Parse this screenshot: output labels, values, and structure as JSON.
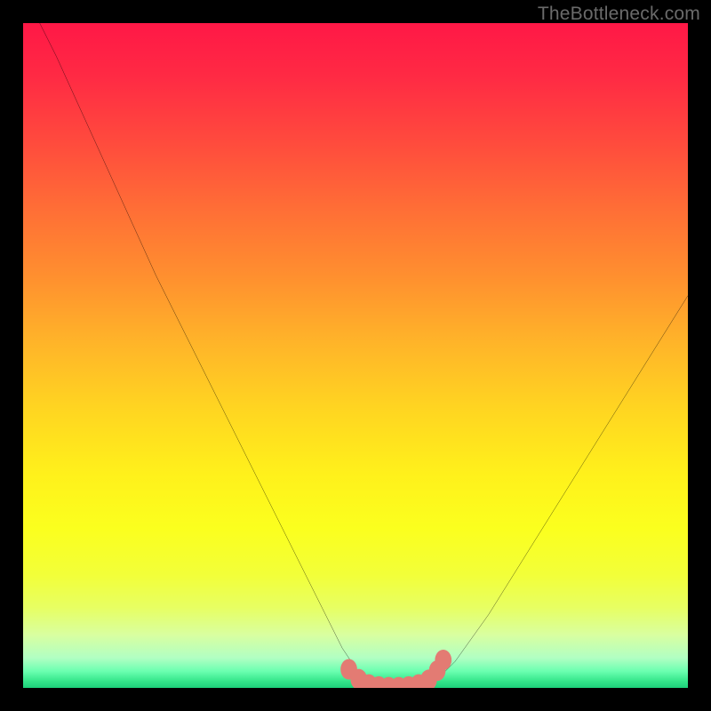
{
  "watermark": {
    "text": "TheBottleneck.com"
  },
  "chart_data": {
    "type": "line",
    "title": "",
    "xlabel": "",
    "ylabel": "",
    "xlim": [
      0,
      100
    ],
    "ylim": [
      0,
      100
    ],
    "grid": false,
    "series": [
      {
        "name": "bottleneck-curve",
        "x": [
          0,
          5,
          10,
          15,
          20,
          25,
          30,
          35,
          40,
          45,
          48,
          50,
          52,
          55,
          58,
          60,
          62,
          65,
          70,
          75,
          80,
          85,
          90,
          95,
          100
        ],
        "values": [
          105,
          95,
          84,
          73,
          62,
          52,
          42,
          32,
          22,
          12,
          6,
          3,
          1,
          0,
          0,
          0,
          1,
          4,
          11,
          19,
          27,
          35,
          43,
          51,
          59
        ]
      }
    ],
    "markers": {
      "name": "flat-region-markers",
      "color": "#e37b73",
      "points": [
        {
          "x": 49,
          "y": 2.8
        },
        {
          "x": 50.5,
          "y": 1.3
        },
        {
          "x": 52,
          "y": 0.5
        },
        {
          "x": 53.5,
          "y": 0.2
        },
        {
          "x": 55,
          "y": 0.1
        },
        {
          "x": 56.5,
          "y": 0.1
        },
        {
          "x": 58,
          "y": 0.2
        },
        {
          "x": 59.5,
          "y": 0.5
        },
        {
          "x": 61,
          "y": 1.2
        },
        {
          "x": 62.3,
          "y": 2.6
        },
        {
          "x": 63.2,
          "y": 4.2
        }
      ]
    },
    "bottom_bands": [
      {
        "y": 92.8,
        "h": 1.0,
        "color": "rgba(255,255,255,0.22)"
      },
      {
        "y": 94.4,
        "h": 0.8,
        "color": "rgba(190,255,210,0.55)"
      },
      {
        "y": 95.6,
        "h": 0.9,
        "color": "rgba(140,255,190,0.55)"
      },
      {
        "y": 96.8,
        "h": 0.9,
        "color": "rgba(90,240,165,0.60)"
      },
      {
        "y": 98.0,
        "h": 1.0,
        "color": "rgba(50,215,140,0.65)"
      },
      {
        "y": 99.1,
        "h": 0.9,
        "color": "rgba(30,200,120,0.70)"
      }
    ]
  }
}
